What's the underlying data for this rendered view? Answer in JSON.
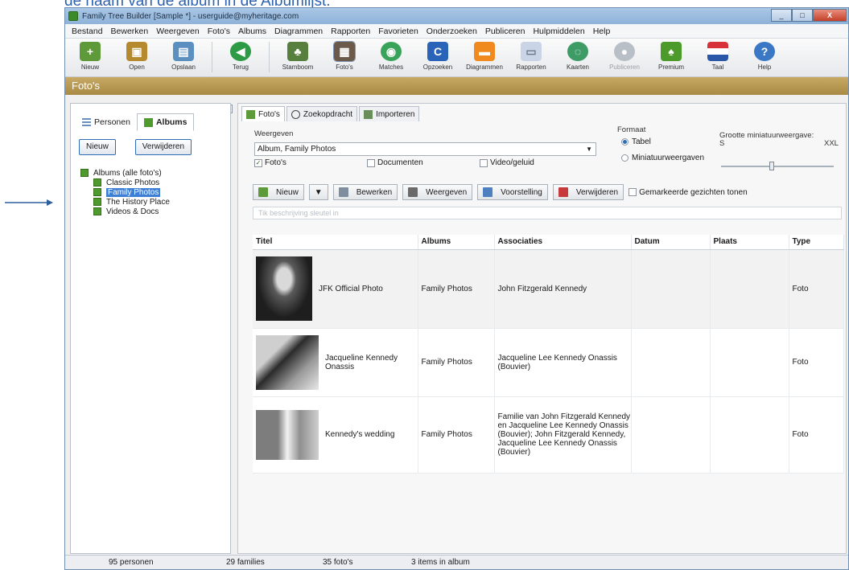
{
  "caption": "de naam van de album in de Albumlijst.",
  "window": {
    "title": "Family Tree Builder [Sample *] - userguide@myheritage.com",
    "btn_min": "_",
    "btn_max": "□",
    "btn_close": "X"
  },
  "menu": [
    "Bestand",
    "Bewerken",
    "Weergeven",
    "Foto's",
    "Albums",
    "Diagrammen",
    "Rapporten",
    "Favorieten",
    "Onderzoeken",
    "Publiceren",
    "Hulpmiddelen",
    "Help"
  ],
  "toolbar": [
    {
      "label": "Nieuw",
      "icon": "new-icon",
      "color": "#5f9a3a"
    },
    {
      "label": "Open",
      "icon": "open-icon",
      "color": "#b58a2f"
    },
    {
      "label": "Opslaan",
      "icon": "save-icon",
      "color": "#5b8fbf"
    },
    {
      "label": "Terug",
      "icon": "back-icon",
      "color": "#2d9a45"
    },
    {
      "label": "Stamboom",
      "icon": "tree-icon",
      "color": "#577f3d"
    },
    {
      "label": "Foto's",
      "icon": "photos-icon",
      "color": "#6b5a4a"
    },
    {
      "label": "Matches",
      "icon": "matches-icon",
      "color": "#3aa35a"
    },
    {
      "label": "Opzoeken",
      "icon": "lookup-icon",
      "color": "#2a64b8"
    },
    {
      "label": "Diagrammen",
      "icon": "charts-icon",
      "color": "#f08a1e"
    },
    {
      "label": "Rapporten",
      "icon": "reports-icon",
      "color": "#c9d5e6"
    },
    {
      "label": "Kaarten",
      "icon": "map-icon",
      "color": "#3d9b66"
    },
    {
      "label": "Publiceren",
      "icon": "publish-icon",
      "color": "#b9bfc6"
    },
    {
      "label": "Premium",
      "icon": "premium-icon",
      "color": "#4c9a2a"
    },
    {
      "label": "Taal",
      "icon": "flag-icon",
      "color": "#d7323a"
    },
    {
      "label": "Help",
      "icon": "help-icon",
      "color": "#3a78c6"
    }
  ],
  "section_title": "Foto's",
  "left": {
    "collapse": "▲ ▼",
    "tabs": [
      "Personen",
      "Albums"
    ],
    "btn_new": "Nieuw",
    "btn_delete": "Verwijderen",
    "tree_root": "Albums (alle foto's)",
    "albums": [
      "Classic Photos",
      "Family Photos",
      "The History Place",
      "Videos & Docs"
    ]
  },
  "right": {
    "tabs": [
      "Foto's",
      "Zoekopdracht",
      "Importeren"
    ],
    "view_label": "Weergeven",
    "view_value": "Album, Family Photos",
    "caret": "▼",
    "checks": [
      "Foto's",
      "Documenten",
      "Video/geluid"
    ],
    "check_mark": "✓",
    "format_label": "Formaat",
    "format_opts": [
      "Tabel",
      "Miniatuurweergaven"
    ],
    "size_label": "Grootte miniatuurweergave:",
    "size_min": "S",
    "size_max": "XXL",
    "actions": [
      "Nieuw",
      "Bewerken",
      "Weergeven",
      "Voorstelling",
      "Verwijderen"
    ],
    "action_dropdown": "▼",
    "action_colors": [
      "#5c9a3a",
      "#7e8e9e",
      "#6a6a6a",
      "#4d7fc1",
      "#c7393b"
    ],
    "show_faces": "Gemarkeerde gezichten tonen",
    "search_placeholder": "Tik beschrijving sleutel in",
    "columns": [
      "Titel",
      "Albums",
      "Associaties",
      "Datum",
      "Plaats",
      "Type"
    ],
    "rows": [
      {
        "title": "JFK Official Photo",
        "album": "Family Photos",
        "assoc": "John Fitzgerald Kennedy",
        "date": "",
        "place": "",
        "type": "Foto"
      },
      {
        "title": "Jacqueline Kennedy Onassis",
        "album": "Family Photos",
        "assoc": "Jacqueline Lee Kennedy Onassis (Bouvier)",
        "date": "",
        "place": "",
        "type": "Foto"
      },
      {
        "title": "Kennedy's wedding",
        "album": "Family Photos",
        "assoc": "Familie van John Fitzgerald Kennedy en Jacqueline Lee Kennedy Onassis (Bouvier); John Fitzgerald Kennedy, Jacqueline Lee Kennedy Onassis (Bouvier)",
        "date": "",
        "place": "",
        "type": "Foto"
      }
    ]
  },
  "status": [
    "95 personen",
    "29 families",
    "35 foto's",
    "3 items in album"
  ]
}
